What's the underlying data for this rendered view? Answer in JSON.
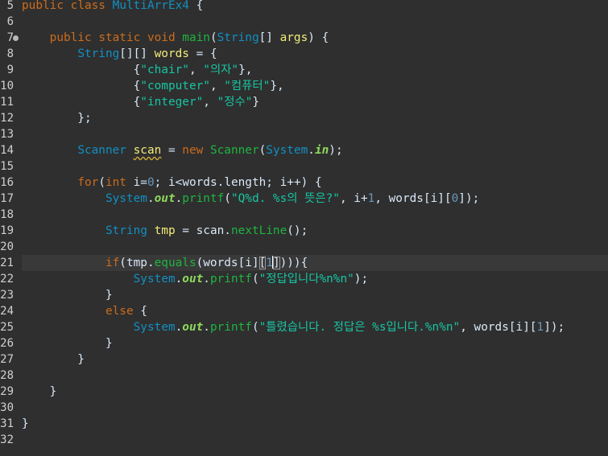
{
  "editor": {
    "language": "java",
    "line_numbers": [
      "5",
      "6",
      "7",
      "8",
      "9",
      "10",
      "11",
      "12",
      "13",
      "14",
      "15",
      "16",
      "17",
      "18",
      "19",
      "20",
      "21",
      "22",
      "23",
      "24",
      "25",
      "26",
      "27",
      "28",
      "29",
      "30",
      "31",
      "32"
    ],
    "lines": [
      [
        [
          "kw",
          "public"
        ],
        [
          "plain",
          " "
        ],
        [
          "kw",
          "class"
        ],
        [
          "plain",
          " "
        ],
        [
          "cls",
          "MultiArrEx4"
        ],
        [
          "plain",
          " {"
        ]
      ],
      [],
      [
        [
          "plain",
          "    "
        ],
        [
          "kw",
          "public"
        ],
        [
          "plain",
          " "
        ],
        [
          "kw",
          "static"
        ],
        [
          "plain",
          " "
        ],
        [
          "kw",
          "void"
        ],
        [
          "plain",
          " "
        ],
        [
          "fn",
          "main"
        ],
        [
          "plain",
          "("
        ],
        [
          "cls",
          "String"
        ],
        [
          "plain",
          "[] "
        ],
        [
          "var",
          "args"
        ],
        [
          "plain",
          ") {"
        ]
      ],
      [
        [
          "plain",
          "        "
        ],
        [
          "cls",
          "String"
        ],
        [
          "plain",
          "[][] "
        ],
        [
          "var",
          "words"
        ],
        [
          "plain",
          " = {"
        ]
      ],
      [
        [
          "plain",
          "                {"
        ],
        [
          "str",
          "\"chair\""
        ],
        [
          "plain",
          ", "
        ],
        [
          "str",
          "\"의자\""
        ],
        [
          "plain",
          "},"
        ]
      ],
      [
        [
          "plain",
          "                {"
        ],
        [
          "str",
          "\"computer\""
        ],
        [
          "plain",
          ", "
        ],
        [
          "str",
          "\"컴퓨터\""
        ],
        [
          "plain",
          "},"
        ]
      ],
      [
        [
          "plain",
          "                {"
        ],
        [
          "str",
          "\"integer\""
        ],
        [
          "plain",
          ", "
        ],
        [
          "str",
          "\"정수\""
        ],
        [
          "plain",
          "}"
        ]
      ],
      [
        [
          "plain",
          "        };"
        ]
      ],
      [],
      [
        [
          "plain",
          "        "
        ],
        [
          "cls",
          "Scanner"
        ],
        [
          "plain",
          " "
        ],
        [
          "warnvar",
          "scan"
        ],
        [
          "plain",
          " = "
        ],
        [
          "kw",
          "new"
        ],
        [
          "plain",
          " "
        ],
        [
          "fn",
          "Scanner"
        ],
        [
          "plain",
          "("
        ],
        [
          "cls",
          "System"
        ],
        [
          "plain",
          "."
        ],
        [
          "static",
          "in"
        ],
        [
          "plain",
          ");"
        ]
      ],
      [],
      [
        [
          "plain",
          "        "
        ],
        [
          "kw",
          "for"
        ],
        [
          "plain",
          "("
        ],
        [
          "kw",
          "int"
        ],
        [
          "plain",
          " i="
        ],
        [
          "num",
          "0"
        ],
        [
          "plain",
          "; i<"
        ],
        [
          "plain",
          "words"
        ],
        [
          "plain",
          "."
        ],
        [
          "plain",
          "length"
        ],
        [
          "plain",
          "; i++) {"
        ]
      ],
      [
        [
          "plain",
          "            "
        ],
        [
          "cls",
          "System"
        ],
        [
          "plain",
          "."
        ],
        [
          "field",
          "out"
        ],
        [
          "plain",
          "."
        ],
        [
          "fn",
          "printf"
        ],
        [
          "plain",
          "("
        ],
        [
          "str",
          "\"Q%d. %s의 뜻은?\""
        ],
        [
          "plain",
          ", i+"
        ],
        [
          "num",
          "1"
        ],
        [
          "plain",
          ", words[i]["
        ],
        [
          "num",
          "0"
        ],
        [
          "plain",
          "]);"
        ]
      ],
      [],
      [
        [
          "plain",
          "            "
        ],
        [
          "cls",
          "String"
        ],
        [
          "plain",
          " "
        ],
        [
          "var",
          "tmp"
        ],
        [
          "plain",
          " = scan."
        ],
        [
          "fn",
          "nextLine"
        ],
        [
          "plain",
          "();"
        ]
      ],
      [],
      [
        [
          "plain",
          "            "
        ],
        [
          "kw",
          "if"
        ],
        [
          "plain",
          "(tmp."
        ],
        [
          "fn",
          "equals"
        ],
        [
          "plain",
          "(words[i]"
        ],
        [
          "box",
          "["
        ],
        [
          "num",
          "1"
        ],
        [
          "caret",
          ""
        ],
        [
          "box",
          "]"
        ],
        [
          "plain",
          "))){"
        ]
      ],
      [
        [
          "plain",
          "                "
        ],
        [
          "cls",
          "System"
        ],
        [
          "plain",
          "."
        ],
        [
          "field",
          "out"
        ],
        [
          "plain",
          "."
        ],
        [
          "fn",
          "printf"
        ],
        [
          "plain",
          "("
        ],
        [
          "str",
          "\"정답입니다%n%n\""
        ],
        [
          "plain",
          ");"
        ]
      ],
      [
        [
          "plain",
          "            }"
        ]
      ],
      [
        [
          "plain",
          "            "
        ],
        [
          "kw",
          "else"
        ],
        [
          "plain",
          " {"
        ]
      ],
      [
        [
          "plain",
          "                "
        ],
        [
          "cls",
          "System"
        ],
        [
          "plain",
          "."
        ],
        [
          "field",
          "out"
        ],
        [
          "plain",
          "."
        ],
        [
          "fn",
          "printf"
        ],
        [
          "plain",
          "("
        ],
        [
          "str",
          "\"틀렸습니다. 정답은 %s입니다.%n%n\""
        ],
        [
          "plain",
          ", words[i]["
        ],
        [
          "num",
          "1"
        ],
        [
          "plain",
          "]);"
        ]
      ],
      [
        [
          "plain",
          "            }"
        ]
      ],
      [
        [
          "plain",
          "        }"
        ]
      ],
      [],
      [
        [
          "plain",
          "    }"
        ]
      ],
      [],
      [
        [
          "plain",
          "}"
        ]
      ],
      []
    ],
    "current_line_index": 16,
    "marker_line_index": 2,
    "colors": {
      "background": "#2f2f2f",
      "current_line": "#393939",
      "keyword": "#cc6c1d",
      "class": "#1290c3",
      "method": "#1eb540",
      "variable": "#f3ec79",
      "string": "#17c6a3",
      "number": "#6897bb",
      "static_field": "#8dda5b",
      "text": "#d9e8f7",
      "line_number": "#cfcfcf"
    }
  }
}
